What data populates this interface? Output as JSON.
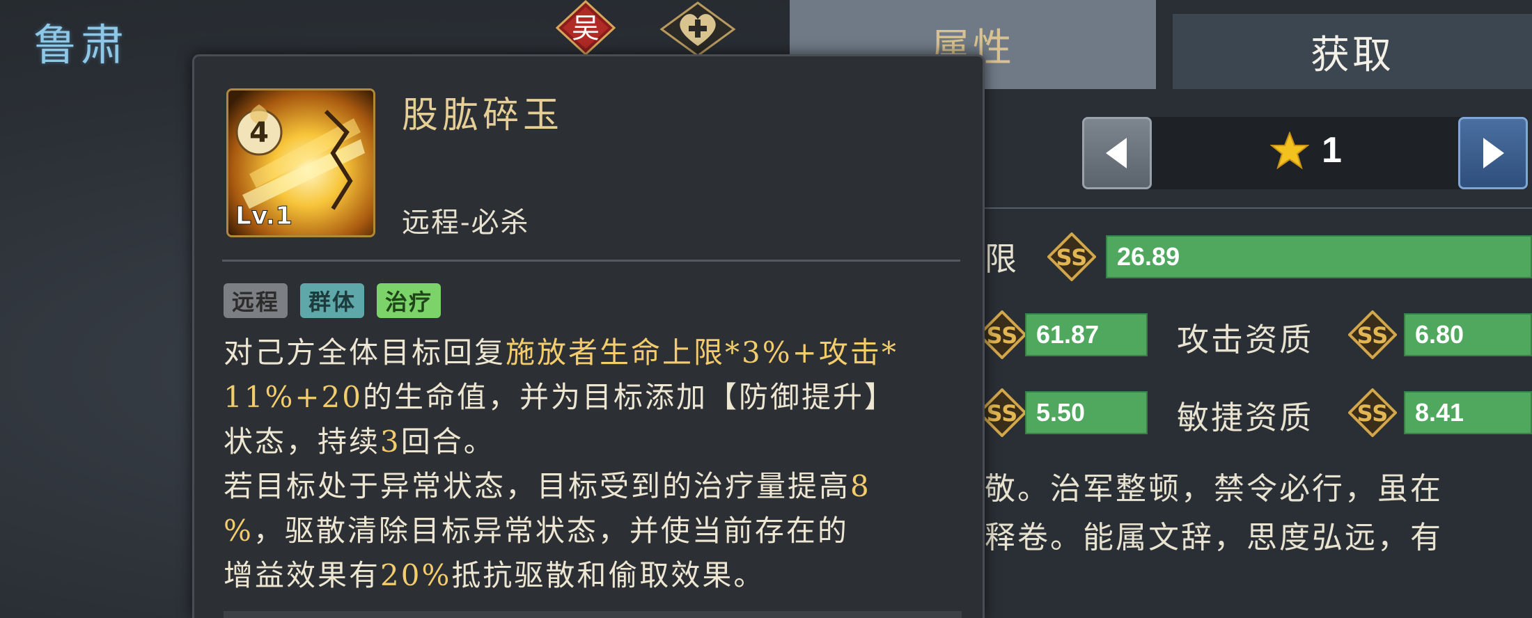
{
  "hero": {
    "name": "鲁肃"
  },
  "badges": {
    "faction": "吴"
  },
  "tabs": {
    "attributes": "属性",
    "obtain": "获取"
  },
  "star_selector": {
    "level": "1"
  },
  "stats": {
    "hp_label_partial": "限",
    "hp_value": "26.89",
    "row2_left_value": "61.87",
    "attack_label": "攻击资质",
    "attack_value": "6.80",
    "row3_left_value": "5.50",
    "agility_label": "敏捷资质",
    "agility_value": "8.41"
  },
  "bio": {
    "line1": "敬。治军整顿，禁令必行，虽在",
    "line2": "释卷。能属文辞，思度弘远，有"
  },
  "skill": {
    "cost": "4",
    "level": "Lv.1",
    "name": "股肱碎玉",
    "type": "远程-必杀",
    "tags": [
      "远程",
      "群体",
      "治疗"
    ],
    "description": {
      "p1_a": "对己方全体目标回复",
      "p1_b": "施放者生命上限*3%+攻击*",
      "p1_c": "11%+20",
      "p1_d": "的生命值，并为目标添加【防御提升】",
      "p1_e": "状态，持续",
      "p1_f": "3",
      "p1_g": "回合。",
      "p2_a": "若目标处于异常状态，目标受到的治疗量提高",
      "p2_b": "8",
      "p2_c": "%",
      "p2_d": "，驱散清除目标异常状态，并使当前存在的",
      "p2_e": "增益效果有",
      "p2_f": "20%",
      "p2_g": "抵抗驱散和偷取效果。"
    }
  },
  "colors": {
    "highlight": "#f2cc6d",
    "bar_green": "#4fa85e",
    "hero_name": "#8fc8e6",
    "tag_heal": "#7bd36a",
    "tag_group": "#5fa8aa"
  }
}
